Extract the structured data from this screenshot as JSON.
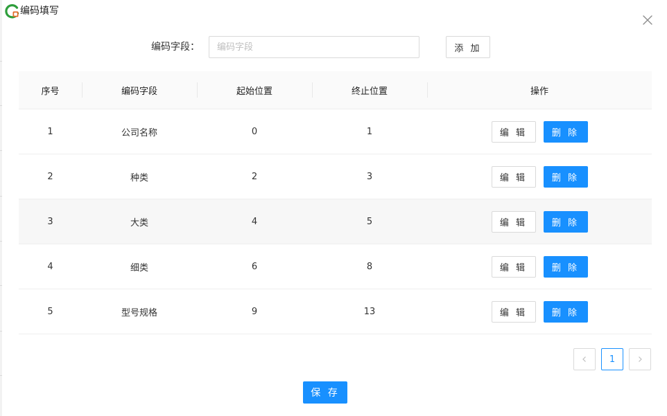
{
  "dialog": {
    "title": "编码填写"
  },
  "form": {
    "label": "编码字段：",
    "input_value": "",
    "input_placeholder": "编码字段",
    "add_label": "添 加"
  },
  "table": {
    "headers": [
      "序号",
      "编码字段",
      "起始位置",
      "终止位置",
      "操作"
    ],
    "rows": [
      {
        "index": "1",
        "field": "公司名称",
        "start": "0",
        "end": "1"
      },
      {
        "index": "2",
        "field": "种类",
        "start": "2",
        "end": "3"
      },
      {
        "index": "3",
        "field": "大类",
        "start": "4",
        "end": "5"
      },
      {
        "index": "4",
        "field": "细类",
        "start": "6",
        "end": "8"
      },
      {
        "index": "5",
        "field": "型号规格",
        "start": "9",
        "end": "13"
      }
    ],
    "edit_label": "编 辑",
    "delete_label": "删 除"
  },
  "pagination": {
    "current_page": "1"
  },
  "save_label": "保 存",
  "colors": {
    "primary": "#1890ff",
    "border": "#d9d9d9",
    "header_bg": "#fafafa",
    "striped_row_bg": "#f7f7f7",
    "logo_green": "#2e9e3b",
    "logo_orange": "#e36b2a"
  },
  "icons": {
    "logo": "app-logo-icon",
    "close": "close-icon",
    "prev": "chevron-left-icon",
    "next": "chevron-right-icon"
  }
}
